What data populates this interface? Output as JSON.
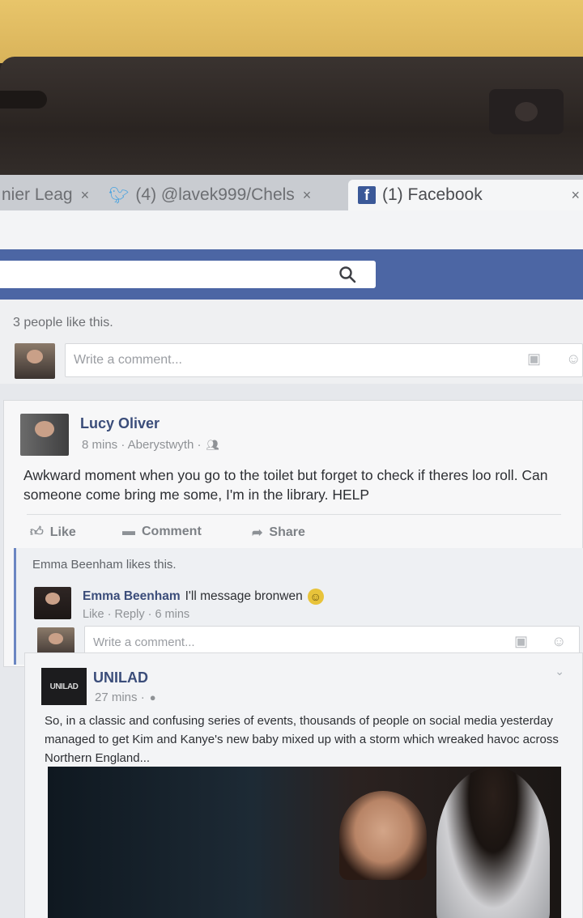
{
  "browser": {
    "tabs": [
      {
        "label": "nier Leag",
        "active": false
      },
      {
        "label": "(4) @lavek999/Chels",
        "active": false
      },
      {
        "label": "(1) Facebook",
        "active": true
      }
    ],
    "close_glyph": "×"
  },
  "colors": {
    "facebook_blue": "#4c66a4",
    "link_name": "#3b4d7a"
  },
  "feed": {
    "top_card": {
      "likes_text": "3 people like this.",
      "comment_placeholder": "Write a comment..."
    },
    "lucy_post": {
      "author": "Lucy Oliver",
      "meta": "8 mins · Aberystwyth ·",
      "text": "Awkward moment when you go to the toilet but forget to check if theres loo roll. Can someone come bring me some, I'm in the library. HELP",
      "actions": {
        "like": "Like",
        "comment": "Comment",
        "share": "Share"
      },
      "likes_text": "Emma Beenham likes this.",
      "reply": {
        "author": "Emma Beenham",
        "text": "I'll message bronwen",
        "like": "Like",
        "reply": "Reply",
        "time": "6 mins"
      },
      "comment_placeholder": "Write a comment..."
    },
    "unilad_post": {
      "author": "UNILAD",
      "logo_text": "UNILAD",
      "meta": "27 mins ·",
      "text": "So, in a classic and confusing series of events, thousands of people on social media yesterday managed to get Kim and Kanye's new baby mixed up with a storm which wreaked havoc across Northern England..."
    }
  }
}
